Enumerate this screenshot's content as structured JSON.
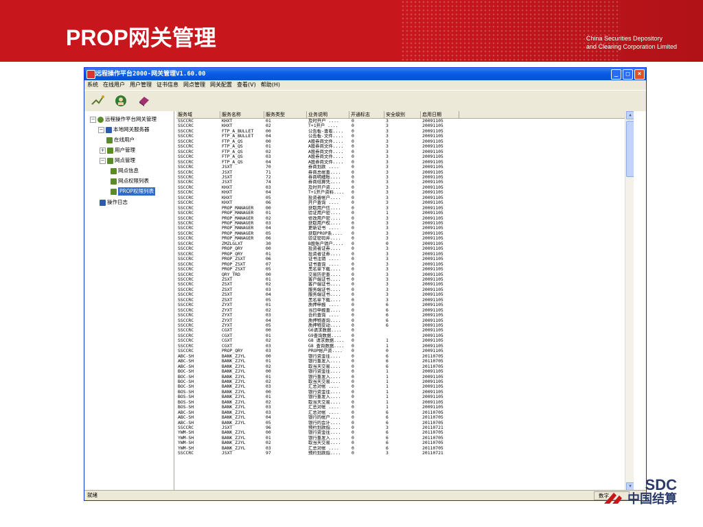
{
  "slide": {
    "title": "PROP网关管理",
    "org_line1": "China Securities Depository",
    "org_line2": "and Clearing Corporation Limited",
    "brand_en": "SDC",
    "brand_cn": "中国结算"
  },
  "window": {
    "title": "远程操作平台2000-网关管理V1.60.00",
    "buttons": [
      "_",
      "□",
      "×"
    ]
  },
  "menu": [
    "系统",
    "在线用户",
    "用户管理",
    "证书信息",
    "网点管理",
    "网关配置",
    "查看(V)",
    "帮助(H)"
  ],
  "toolbar_icons": [
    "connect-icon",
    "user-icon",
    "book-icon"
  ],
  "tree": [
    {
      "label": "远程操作平台网关管理",
      "expander": "⊟"
    },
    {
      "label": "本地网关服务器",
      "expander": "⊟"
    },
    {
      "label": "在线用户",
      "expander": ""
    },
    {
      "label": "用户管理",
      "expander": "⊞"
    },
    {
      "label": "网点管理",
      "expander": "⊟"
    },
    {
      "label": "网点信息",
      "expander": ""
    },
    {
      "label": "网点权限列表",
      "expander": ""
    },
    {
      "label": "PROP权限列表",
      "expander": ""
    },
    {
      "label": "操作日志",
      "expander": ""
    }
  ],
  "table": {
    "columns": [
      "服务域",
      "服务名称",
      "服务类型",
      "业务说明",
      "开通标志",
      "安全级别",
      "启用日期"
    ],
    "rows": [
      [
        "SSCCRC",
        "KHXT",
        "01",
        "及时开户 ....",
        "0",
        "3",
        "20091105"
      ],
      [
        "SSCCRC",
        "KHXT",
        "02",
        "T+1开户 ....",
        "0",
        "3",
        "20091105"
      ],
      [
        "SSCCRC",
        "FTP_A_BULLET",
        "00",
        "公告板-查看....",
        "0",
        "3",
        "20091105"
      ],
      [
        "SSCCRC",
        "FTP_A_BULLET",
        "04",
        "公告板-文件....",
        "0",
        "3",
        "20091105"
      ],
      [
        "SSCCRC",
        "FTP_A_QS",
        "00",
        "A股券商文件....",
        "0",
        "3",
        "20091105"
      ],
      [
        "SSCCRC",
        "FTP_A_QS",
        "01",
        "A股券商文件....",
        "0",
        "3",
        "20091105"
      ],
      [
        "SSCCRC",
        "FTP_A_QS",
        "02",
        "A股券商文件....",
        "0",
        "3",
        "20091105"
      ],
      [
        "SSCCRC",
        "FTP_A_QS",
        "03",
        "A股券商文件....",
        "0",
        "3",
        "20091105"
      ],
      [
        "SSCCRC",
        "FTP_A_QS",
        "04",
        "A股券商文件....",
        "0",
        "3",
        "20091105"
      ],
      [
        "SSCCRC",
        "JSXT",
        "70",
        "券商划款 ....",
        "0",
        "3",
        "20091105"
      ],
      [
        "SSCCRC",
        "JSXT",
        "71",
        "券商总帐查....",
        "0",
        "3",
        "20091105"
      ],
      [
        "SSCCRC",
        "JSXT",
        "72",
        "券商明细账....",
        "0",
        "3",
        "20091105"
      ],
      [
        "SSCCRC",
        "JSXT",
        "74",
        "券商结算凭....",
        "0",
        "3",
        "20091105"
      ],
      [
        "SSCCRC",
        "KHXT",
        "03",
        "及时开户资....",
        "0",
        "3",
        "20091105"
      ],
      [
        "SSCCRC",
        "KHXT",
        "04",
        "T+1开户资料....",
        "0",
        "3",
        "20091105"
      ],
      [
        "SSCCRC",
        "KHXT",
        "05",
        "投资者帐户....",
        "0",
        "3",
        "20091105"
      ],
      [
        "SSCCRC",
        "KHXT",
        "06",
        "开户查询 ....",
        "0",
        "3",
        "20091105"
      ],
      [
        "SSCCRC",
        "PROP_MANAGER",
        "00",
        "获取用户信....",
        "0",
        "3",
        "20091105"
      ],
      [
        "SSCCRC",
        "PROP_MANAGER",
        "01",
        "验证用户密....",
        "0",
        "1",
        "20091105"
      ],
      [
        "SSCCRC",
        "PROP_MANAGER",
        "02",
        "修改用户密....",
        "0",
        "3",
        "20091105"
      ],
      [
        "SSCCRC",
        "PROP_MANAGER",
        "03",
        "获取用户权....",
        "0",
        "3",
        "20091105"
      ],
      [
        "SSCCRC",
        "PROP_MANAGER",
        "04",
        "更新证书 ....",
        "0",
        "3",
        "20091105"
      ],
      [
        "SSCCRC",
        "PROP_MANAGER",
        "05",
        "获取PROP系....",
        "0",
        "3",
        "20091105"
      ],
      [
        "SSCCRC",
        "PROP_MANAGER",
        "06",
        "验证密码并....",
        "0",
        "3",
        "20091105"
      ],
      [
        "SSCCRC",
        "ZMZLGLXT",
        "30",
        "B股账户销户....",
        "0",
        "0",
        "20091105"
      ],
      [
        "SSCCRC",
        "PROP_QRY",
        "00",
        "投资者证券....",
        "0",
        "3",
        "20091105"
      ],
      [
        "SSCCRC",
        "PROP_QRY",
        "01",
        "投资者证券....",
        "0",
        "3",
        "20091105"
      ],
      [
        "SSCCRC",
        "PROP_ZSXT",
        "06",
        "证书注销 ....",
        "0",
        "3",
        "20091105"
      ],
      [
        "SSCCRC",
        "PROP_ZSXT",
        "07",
        "证书查询 ....",
        "0",
        "3",
        "20091105"
      ],
      [
        "SSCCRC",
        "PROP_ZSXT",
        "05",
        "黑名单下载....",
        "0",
        "3",
        "20091105"
      ],
      [
        "SSCCRC",
        "QRY_TRD",
        "00",
        "交易历史查....",
        "0",
        "3",
        "20091105"
      ],
      [
        "SSCCRC",
        "ZSXT",
        "01",
        "客户端证书....",
        "0",
        "3",
        "20091105"
      ],
      [
        "SSCCRC",
        "ZSXT",
        "02",
        "客户端证书....",
        "0",
        "3",
        "20091105"
      ],
      [
        "SSCCRC",
        "ZSXT",
        "03",
        "服务端证书....",
        "0",
        "3",
        "20091105"
      ],
      [
        "SSCCRC",
        "ZSXT",
        "04",
        "服务端证书....",
        "0",
        "3",
        "20091105"
      ],
      [
        "SSCCRC",
        "ZSXT",
        "05",
        "黑名单下载....",
        "0",
        "3",
        "20091105"
      ],
      [
        "SSCCRC",
        "ZYXT",
        "01",
        "质押申报 ....",
        "0",
        "6",
        "20091105"
      ],
      [
        "SSCCRC",
        "ZYXT",
        "02",
        "当日申报查....",
        "0",
        "6",
        "20091105"
      ],
      [
        "SSCCRC",
        "ZYXT",
        "03",
        "合约查询 ....",
        "0",
        "6",
        "20091105"
      ],
      [
        "SSCCRC",
        "ZYXT",
        "04",
        "质押物查询....",
        "0",
        "6",
        "20091105"
      ],
      [
        "SSCCRC",
        "ZYXT",
        "05",
        "质押物变动....",
        "0",
        "6",
        "20091105"
      ],
      [
        "SSCCRC",
        "CGXT",
        "00",
        "G6请求数据....",
        "0",
        "",
        "20091105"
      ],
      [
        "SSCCRC",
        "CGXT",
        "01",
        "G9查询数据....",
        "0",
        "",
        "20091105"
      ],
      [
        "SSCCRC",
        "CGXT",
        "02",
        "G8 请求数据....",
        "0",
        "1",
        "20091105"
      ],
      [
        "SSCCRC",
        "CGXT",
        "03",
        "G8 查询数据....",
        "0",
        "1",
        "20091105"
      ],
      [
        "SSCCRC",
        "PROP_QRY",
        "03",
        "PROP帐户资....",
        "0",
        "0",
        "20091105"
      ],
      [
        "ABC-SH",
        "BANK_ZJYL",
        "00",
        "银行资金往....",
        "0",
        "6",
        "20110705"
      ],
      [
        "ABC-SH",
        "BANK_ZJYL",
        "01",
        "银行重发入....",
        "0",
        "6",
        "20110705"
      ],
      [
        "ABC-SH",
        "BANK_ZJYL",
        "02",
        "取当天交易....",
        "0",
        "6",
        "20110705"
      ],
      [
        "BOC-SH",
        "BANK_ZJYL",
        "00",
        "银行资金往....",
        "0",
        "1",
        "20091105"
      ],
      [
        "BOC-SH",
        "BANK_ZJYL",
        "01",
        "银行重发入....",
        "0",
        "1",
        "20091105"
      ],
      [
        "BOC-SH",
        "BANK_ZJYL",
        "02",
        "取当天交易....",
        "0",
        "1",
        "20091105"
      ],
      [
        "BOC-SH",
        "BANK_ZJYL",
        "03",
        "汇总对帐 ....",
        "0",
        "1",
        "20091105"
      ],
      [
        "BOS-SH",
        "BANK_ZJYL",
        "00",
        "银行资金往....",
        "0",
        "1",
        "20091105"
      ],
      [
        "BOS-SH",
        "BANK_ZJYL",
        "01",
        "银行重发入....",
        "0",
        "1",
        "20091105"
      ],
      [
        "BOS-SH",
        "BANK_ZJYL",
        "02",
        "取当天交易....",
        "0",
        "1",
        "20091105"
      ],
      [
        "BOS-SH",
        "BANK_ZJYL",
        "03",
        "汇总对帐 ....",
        "0",
        "1",
        "20091105"
      ],
      [
        "ABC-SH",
        "BANK_ZJYL",
        "03",
        "汇总对帐 ....",
        "0",
        "6",
        "20110705"
      ],
      [
        "ABC-SH",
        "BANK_ZJYL",
        "04",
        "银行的帐户....",
        "0",
        "6",
        "20110705"
      ],
      [
        "ABC-SH",
        "BANK_ZJYL",
        "05",
        "银行的会计....",
        "0",
        "6",
        "20110705"
      ],
      [
        "SSCCRC",
        "JSXT",
        "96",
        "预约划款指....",
        "0",
        "3",
        "20110721"
      ],
      [
        "YWM-SH",
        "BANK_ZJYL",
        "00",
        "银行资金往....",
        "0",
        "6",
        "20110705"
      ],
      [
        "YWM-SH",
        "BANK_ZJYL",
        "01",
        "银行重发入....",
        "0",
        "6",
        "20110705"
      ],
      [
        "YWM-SH",
        "BANK_ZJYL",
        "02",
        "取当天交易....",
        "0",
        "6",
        "20110705"
      ],
      [
        "YWM-SH",
        "BANK_ZJYL",
        "03",
        "汇总对帐 ....",
        "0",
        "6",
        "20110705"
      ],
      [
        "SSCCRC",
        "JSXT",
        "97",
        "预约划款指....",
        "0",
        "3",
        "20110721"
      ]
    ]
  },
  "status": {
    "left": "就绪",
    "right": "数字"
  },
  "colors": {
    "banner": "#c8161d",
    "titlebar": "#0a5fe8",
    "selection": "#316ac5"
  }
}
